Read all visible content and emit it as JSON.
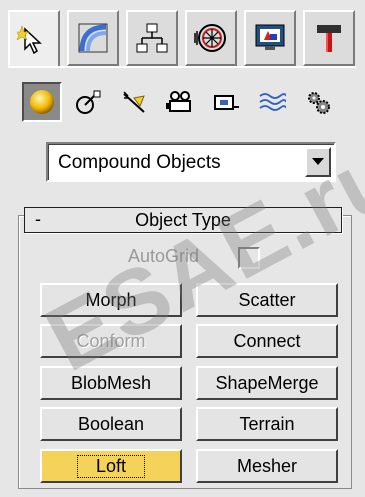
{
  "tabs": [
    {
      "name": "create-tab",
      "icon": "create-cursor-icon",
      "active": true
    },
    {
      "name": "modify-tab",
      "icon": "modify-bend-icon"
    },
    {
      "name": "hierarchy-tab",
      "icon": "hierarchy-icon"
    },
    {
      "name": "motion-tab",
      "icon": "motion-wheel-icon"
    },
    {
      "name": "display-tab",
      "icon": "display-monitor-icon"
    },
    {
      "name": "utilities-tab",
      "icon": "hammer-icon"
    }
  ],
  "subcategories": [
    {
      "name": "geometry",
      "icon": "sphere-icon",
      "active": true
    },
    {
      "name": "shapes",
      "icon": "shapes-icon"
    },
    {
      "name": "lights",
      "icon": "light-icon"
    },
    {
      "name": "cameras",
      "icon": "camera-icon"
    },
    {
      "name": "helpers",
      "icon": "helper-tape-icon"
    },
    {
      "name": "space-warps",
      "icon": "space-warp-icon"
    },
    {
      "name": "systems",
      "icon": "systems-gears-icon"
    }
  ],
  "dropdown": {
    "value": "Compound Objects"
  },
  "rollout": {
    "minus": "-",
    "title": "Object Type"
  },
  "autogrid": {
    "label": "AutoGrid",
    "checked": false
  },
  "buttons": [
    {
      "label": "Morph",
      "state": "normal"
    },
    {
      "label": "Scatter",
      "state": "normal"
    },
    {
      "label": "Conform",
      "state": "disabled"
    },
    {
      "label": "Connect",
      "state": "normal"
    },
    {
      "label": "BlobMesh",
      "state": "normal"
    },
    {
      "label": "ShapeMerge",
      "state": "normal"
    },
    {
      "label": "Boolean",
      "state": "normal"
    },
    {
      "label": "Terrain",
      "state": "normal"
    },
    {
      "label": "Loft",
      "state": "active"
    },
    {
      "label": "Mesher",
      "state": "normal"
    }
  ],
  "watermark": "ESAE.ru",
  "colors": {
    "active_button": "#f5d35a",
    "panel_bg": "#e6e6e6"
  }
}
